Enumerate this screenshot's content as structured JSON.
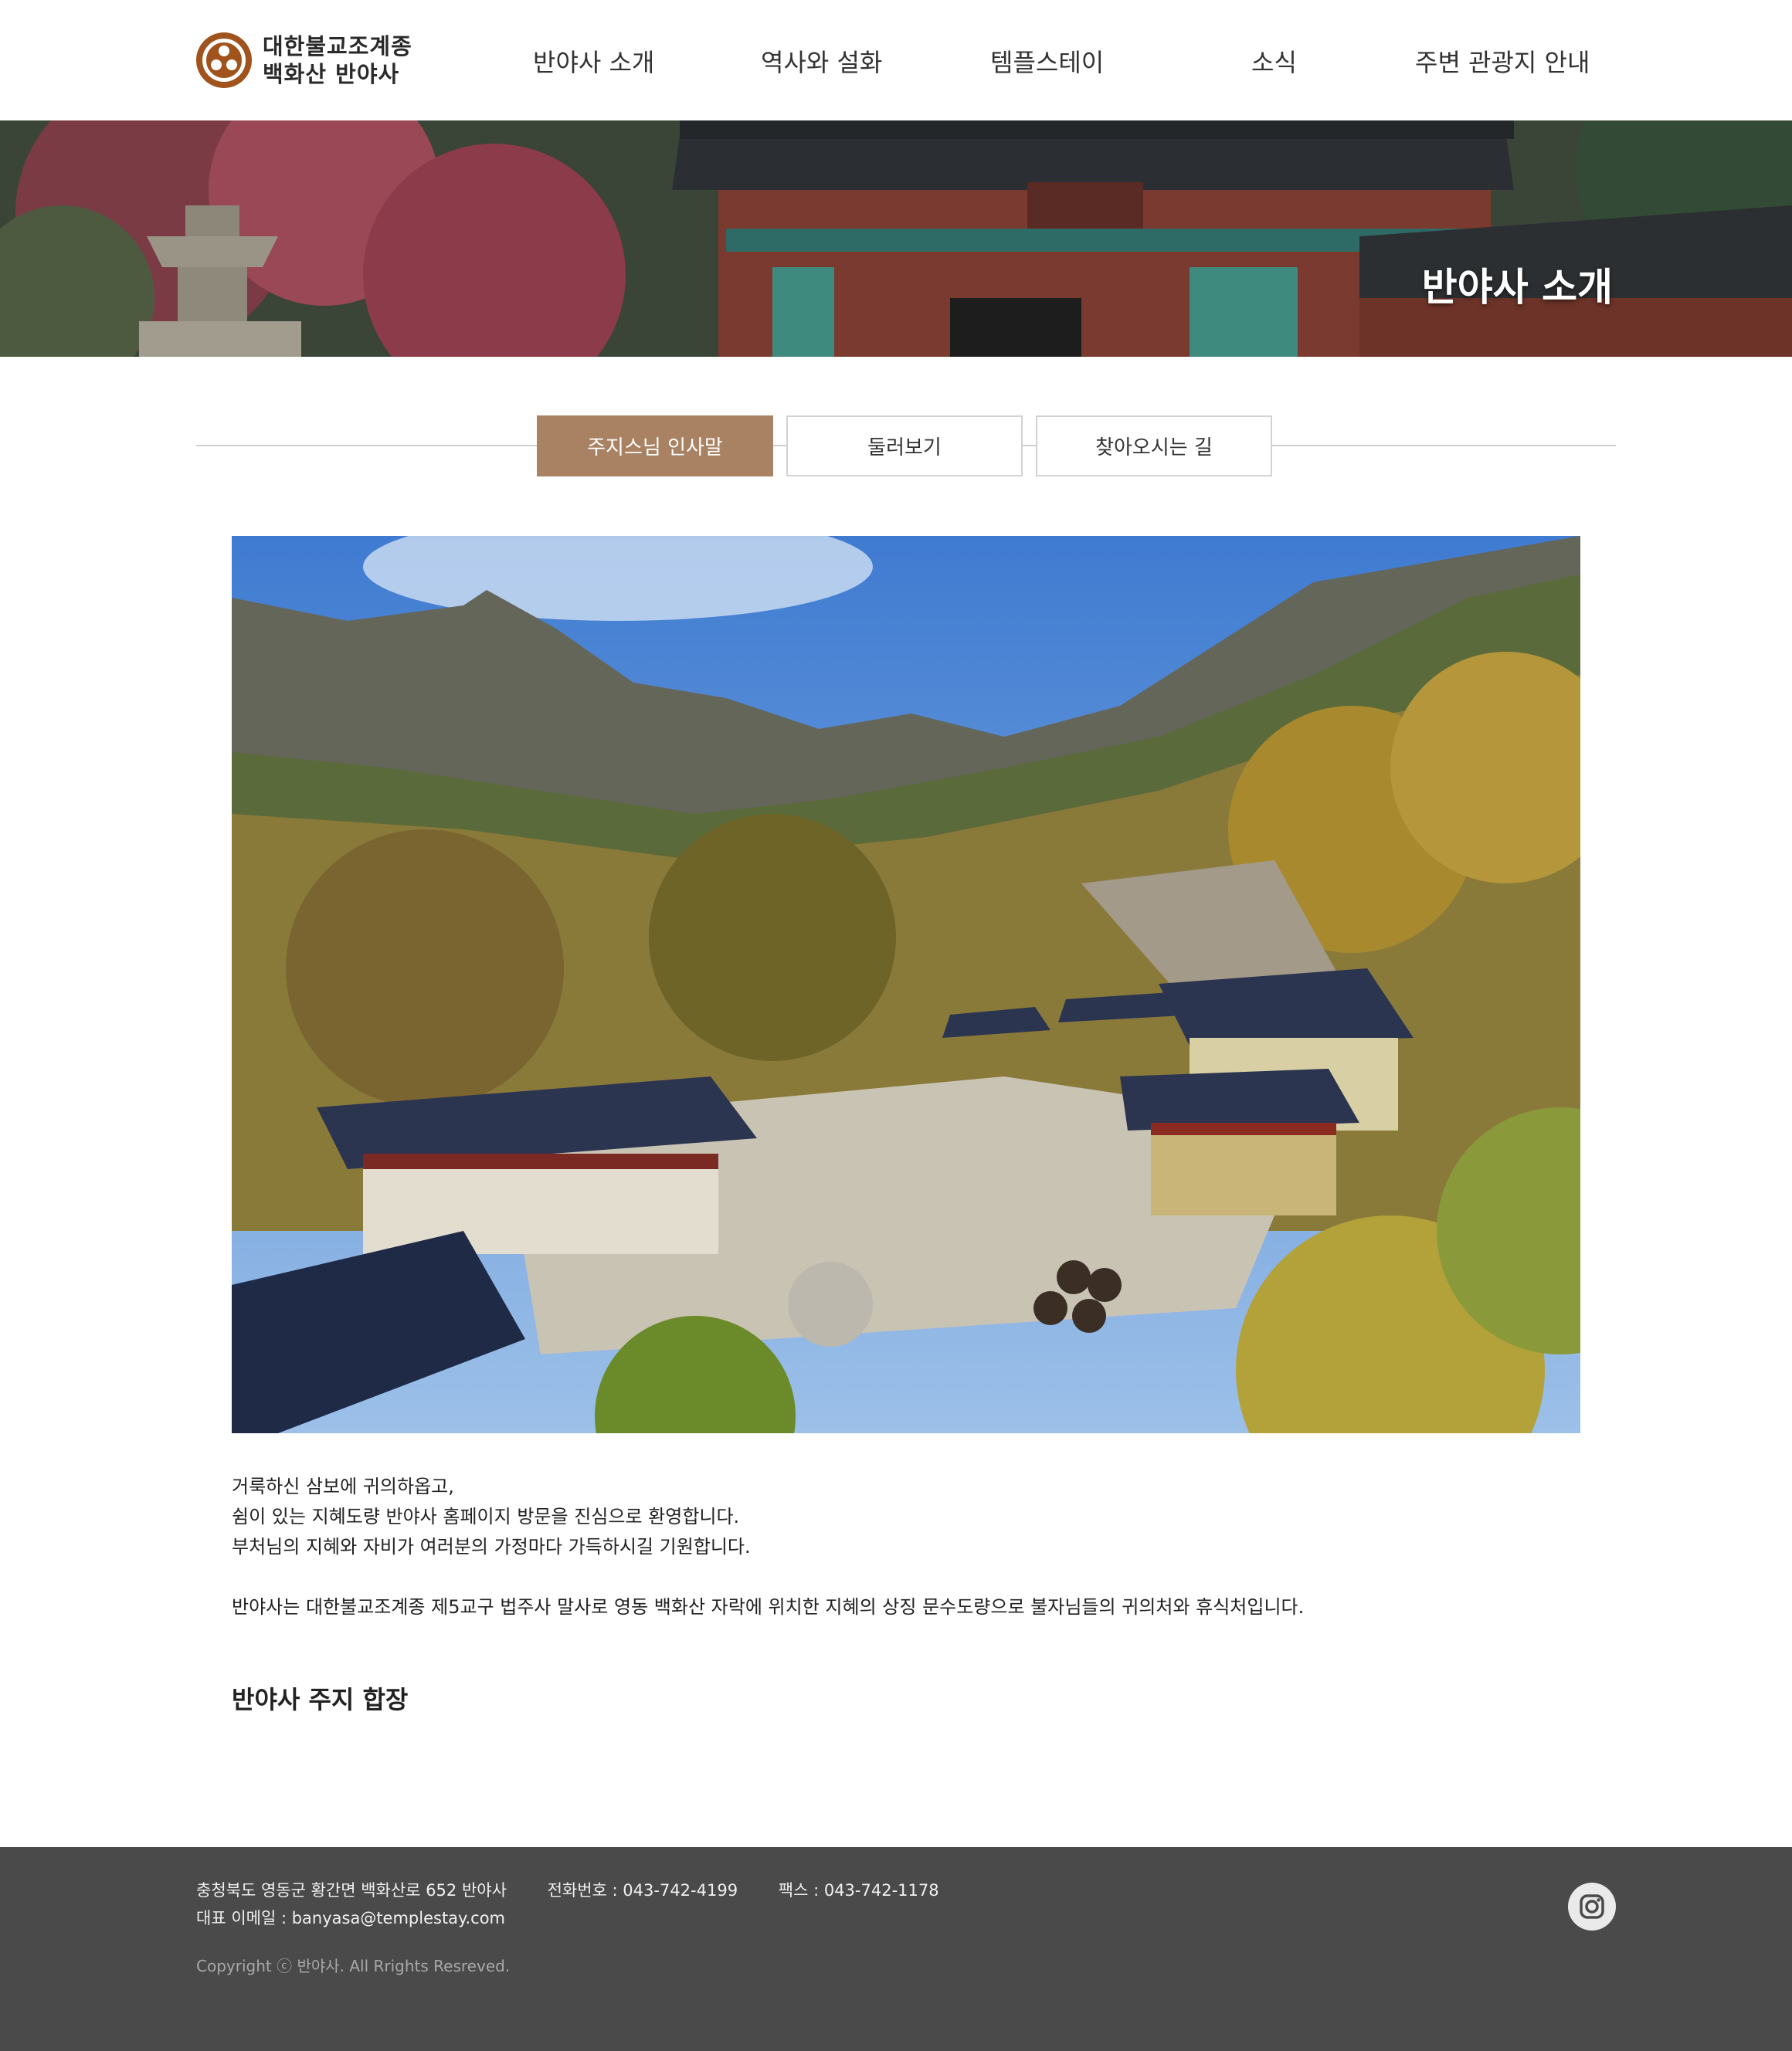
{
  "header": {
    "logo_line1": "대한불교조계종",
    "logo_line2": "백화산 반야사",
    "nav": [
      {
        "label": "반야사 소개"
      },
      {
        "label": "역사와 설화"
      },
      {
        "label": "템플스테이"
      },
      {
        "label": "소식"
      },
      {
        "label": "주변 관광지 안내"
      }
    ]
  },
  "hero": {
    "title": "반야사 소개"
  },
  "tabs": [
    {
      "label": "주지스님 인사말",
      "active": true
    },
    {
      "label": "둘러보기",
      "active": false
    },
    {
      "label": "찾아오시는 길",
      "active": false
    }
  ],
  "greeting": {
    "line1": "거룩하신 삼보에 귀의하옵고,",
    "line2": "쉼이 있는 지혜도량 반야사 홈페이지 방문을 진심으로 환영합니다.",
    "line3": "부처님의 지혜와 자비가 여러분의 가정마다 가득하시길 기원합니다.",
    "line4": "반야사는 대한불교조계종 제5교구 법주사 말사로 영동 백화산 자락에 위치한 지혜의 상징 문수도량으로 불자님들의 귀의처와 휴식처입니다."
  },
  "signature": "반야사 주지 합장",
  "footer": {
    "address": "충청북도 영동군 황간면 백화산로 652 반야사",
    "phone": "전화번호 : 043-742-4199",
    "fax": "팩스 : 043-742-1178",
    "email": "대표 이메일 : banyasa@templestay.com",
    "copyright": "Copyright ⓒ 반야사. All Rrights Resreved."
  },
  "colors": {
    "brand": "#a0531c",
    "tab_active": "#a88262",
    "footer_bg": "#4a4a4a"
  },
  "icons": {
    "logo": "three-dots-circle-logo",
    "social": "instagram-icon"
  }
}
